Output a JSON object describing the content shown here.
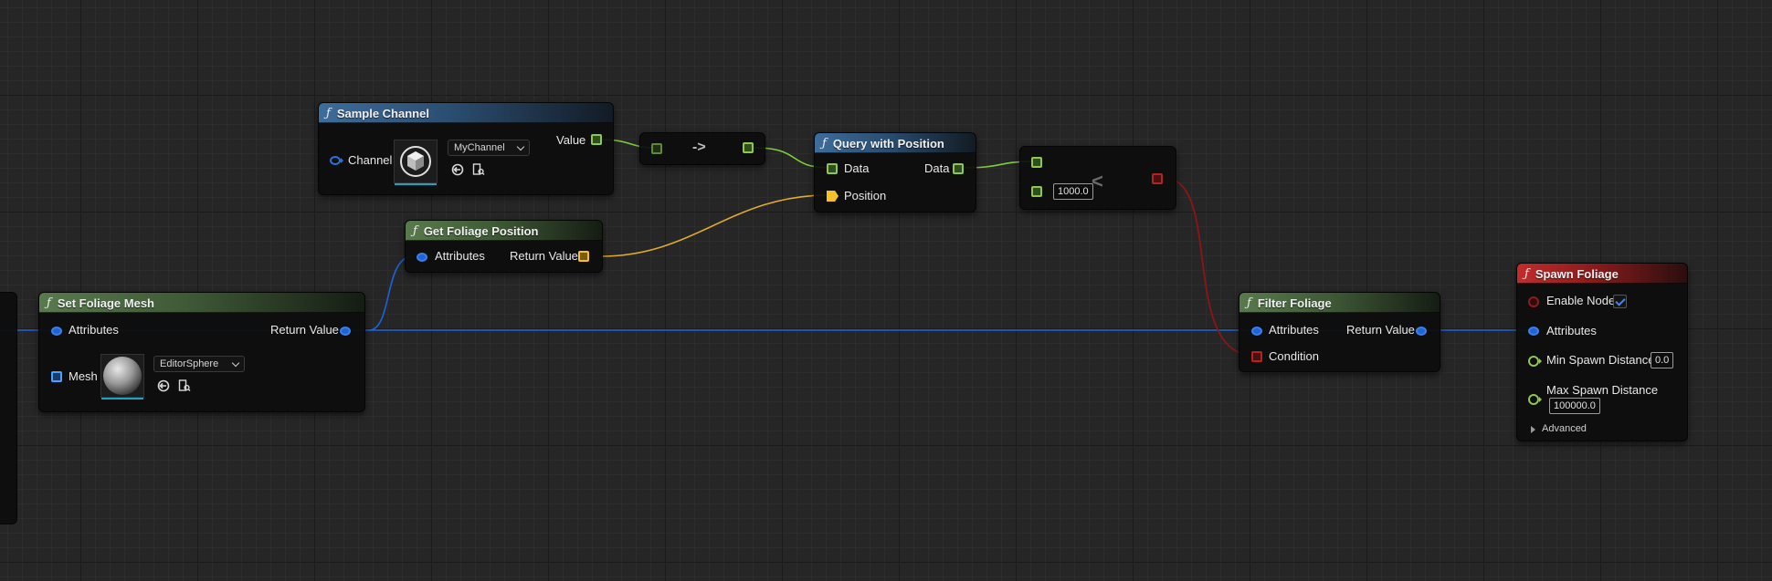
{
  "graph": {
    "nodes": {
      "sample_channel": {
        "title": "Sample Channel",
        "channel_label": "Channel",
        "channel_dropdown": "MyChannel",
        "value_label": "Value"
      },
      "convert_node": {
        "symbol": "->"
      },
      "query_with_position": {
        "title": "Query with Position",
        "data_in_label": "Data",
        "data_out_label": "Data",
        "position_label": "Position"
      },
      "less_than": {
        "symbol": "<",
        "b_value": "1000.0"
      },
      "get_foliage_position": {
        "title": "Get Foliage Position",
        "attributes_label": "Attributes",
        "return_label": "Return Value"
      },
      "set_foliage_mesh": {
        "title": "Set Foliage Mesh",
        "attributes_label": "Attributes",
        "return_label": "Return Value",
        "mesh_label": "Mesh",
        "mesh_dropdown": "EditorSphere"
      },
      "filter_foliage": {
        "title": "Filter Foliage",
        "attributes_label": "Attributes",
        "return_label": "Return Value",
        "condition_label": "Condition"
      },
      "spawn_foliage": {
        "title": "Spawn Foliage",
        "enable_label": "Enable Node",
        "enable_checked": true,
        "attributes_label": "Attributes",
        "min_label": "Min Spawn Distance",
        "min_value": "0.0",
        "max_label": "Max Spawn Distance",
        "max_value": "100000.0",
        "advanced_label": "Advanced"
      }
    },
    "icons": [
      "function-icon",
      "cube-asset-icon",
      "sphere-asset-icon",
      "use-selected-icon",
      "browse-asset-icon",
      "checkmark-icon",
      "expand-arrow-icon"
    ],
    "colors": {
      "background": "#262626",
      "header_function_blue": "#3d6d9c",
      "header_function_green": "#587a4c",
      "header_event_red": "#c12c2c",
      "wire_vector": "#7fcf3a",
      "wire_struct": "#1b63d6",
      "wire_position": "#e0aa2e",
      "wire_bool": "#8f1414",
      "thumbnail_underline": "#17a5c4"
    }
  }
}
